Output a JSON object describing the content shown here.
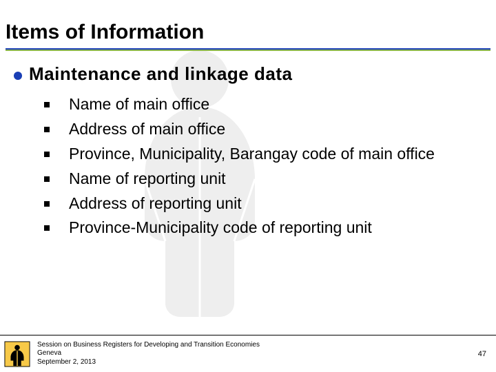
{
  "title": "Items of Information",
  "section_heading": "Maintenance and linkage data",
  "bullets": [
    "Name of main office",
    "Address of main office",
    "Province, Municipality, Barangay code of main office",
    "Name of reporting unit",
    "Address of reporting unit",
    "Province-Municipality code of reporting unit"
  ],
  "footer": {
    "line1": "Session on Business Registers for Developing and Transition Economies",
    "line2": "Geneva",
    "line3": "September 2, 2013"
  },
  "page_number": "47"
}
